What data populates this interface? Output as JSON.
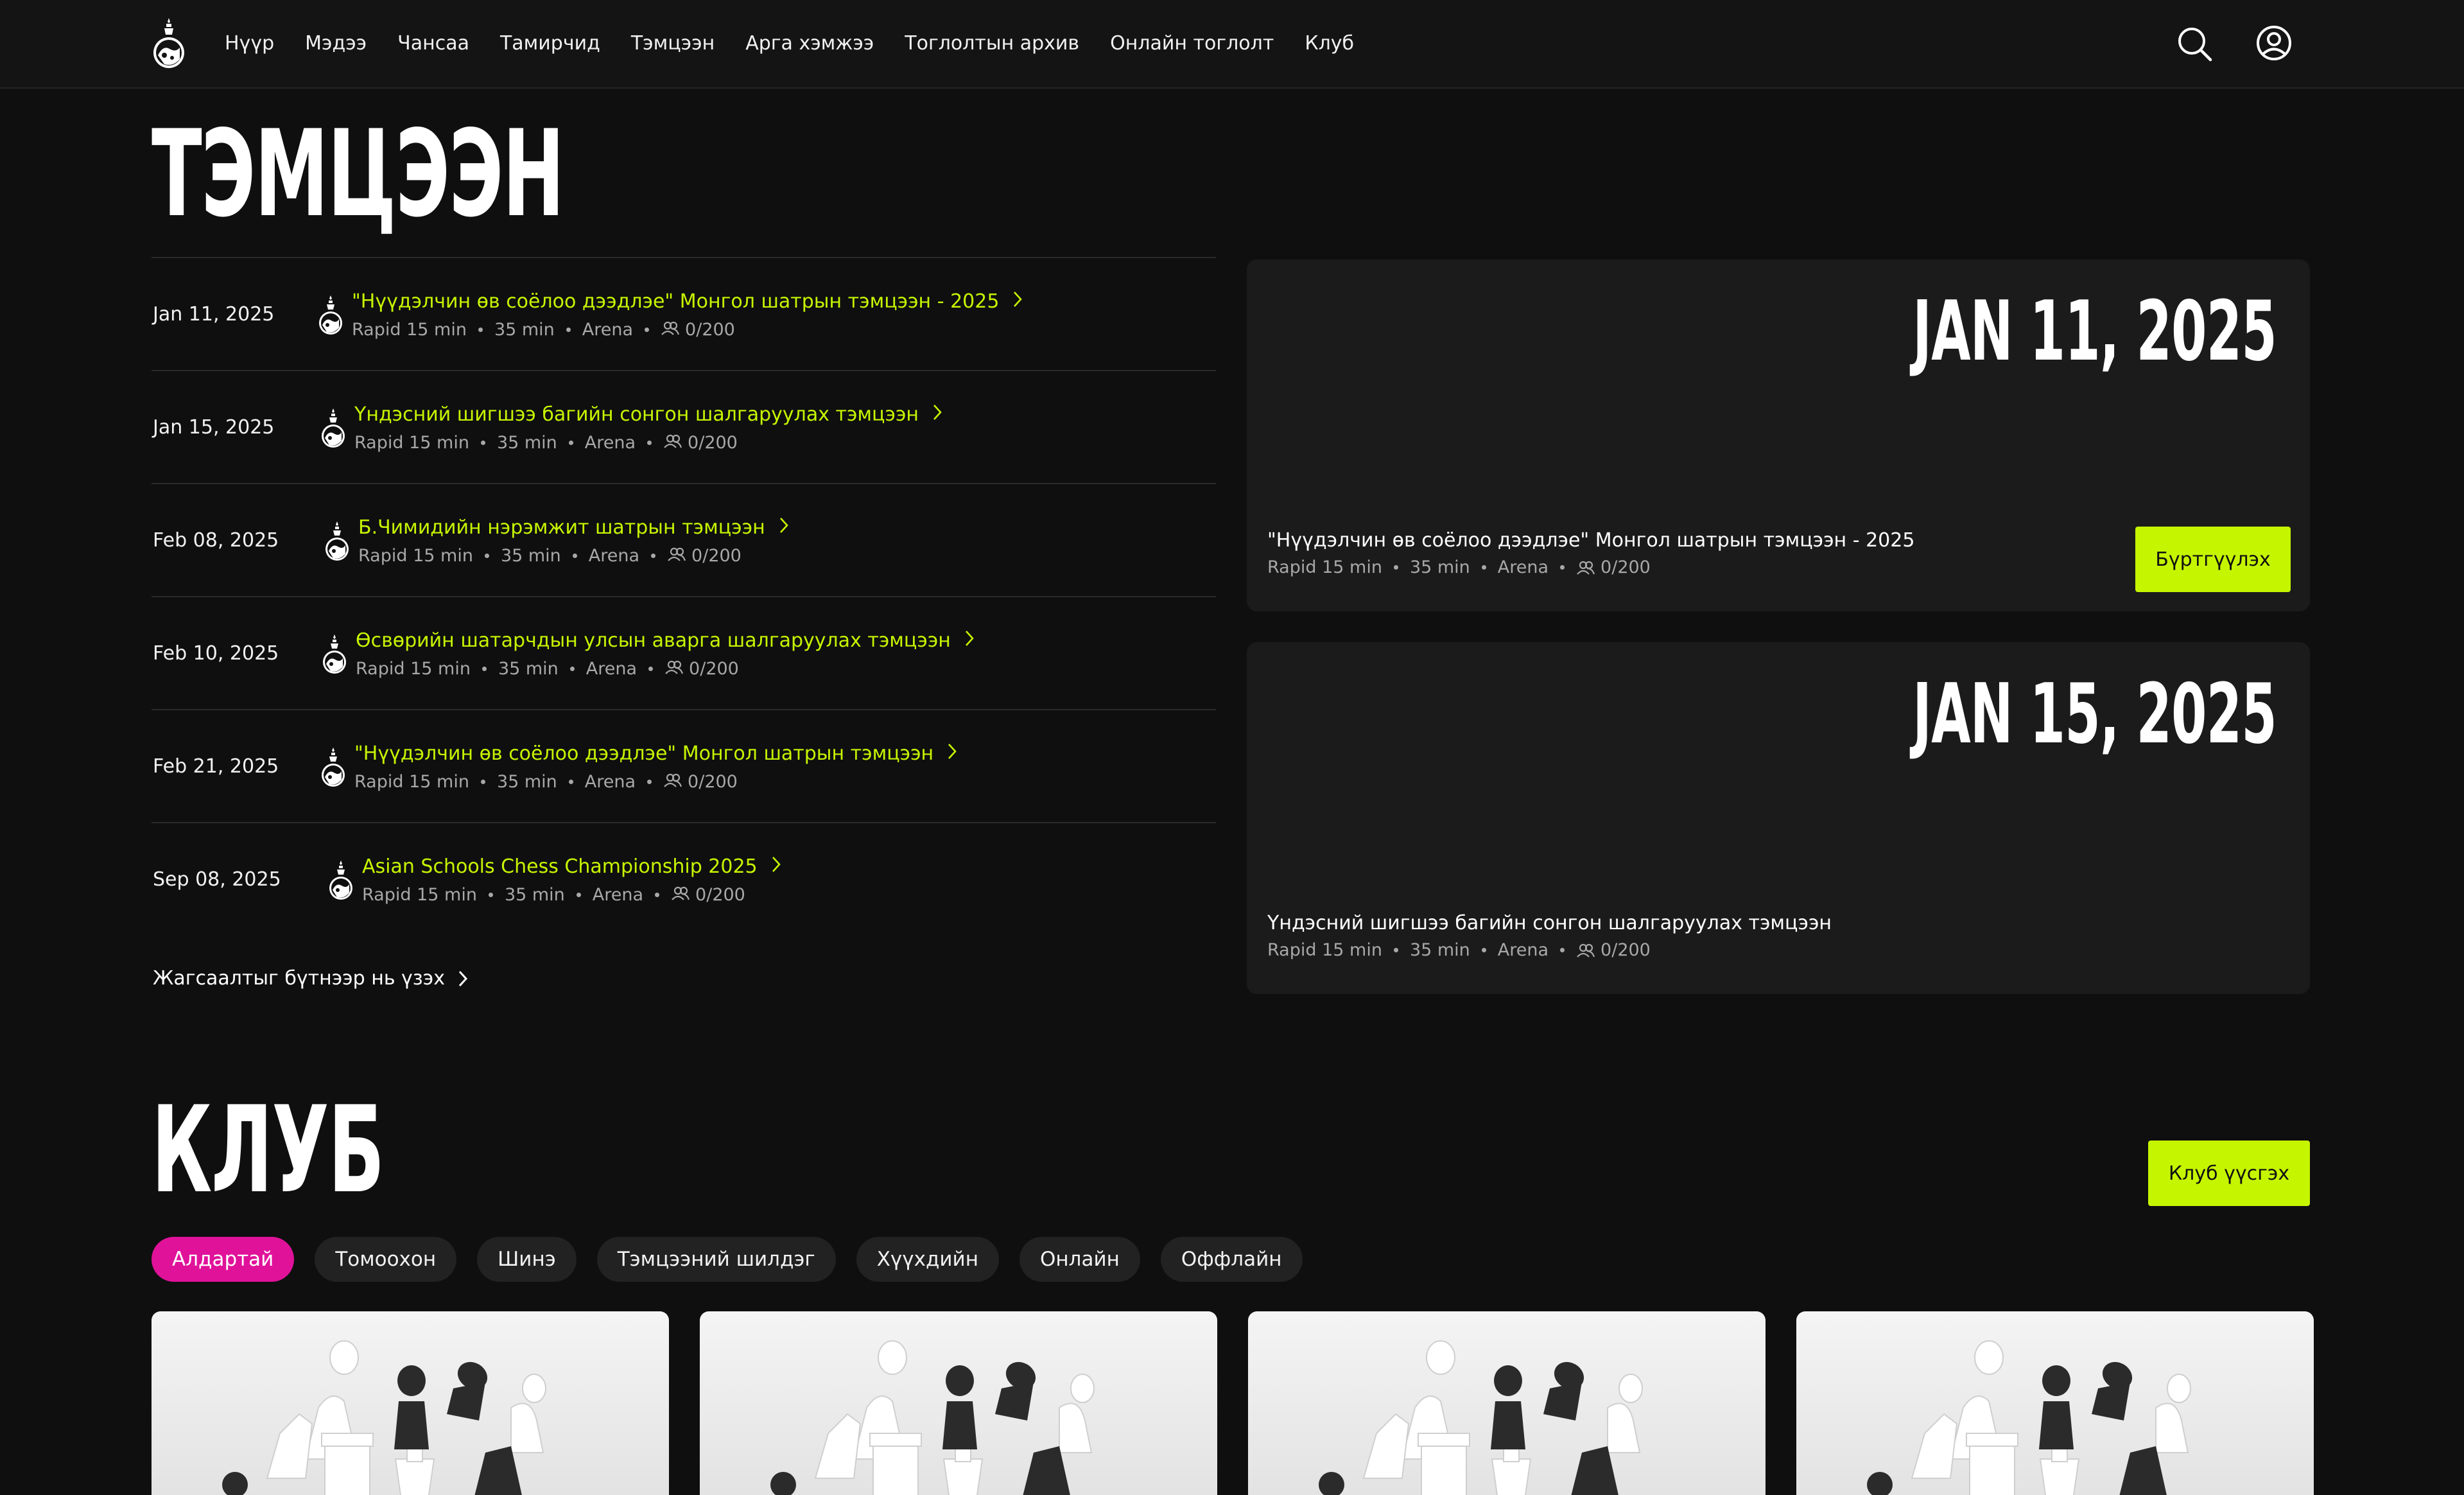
{
  "nav": {
    "items": [
      "Нүүр",
      "Мэдээ",
      "Чансаа",
      "Тамирчид",
      "Тэмцээн",
      "Арга хэмжээ",
      "Тоглолтын архив",
      "Онлайн тоглолт",
      "Клуб"
    ],
    "logo_icon": "chess-king-emblem-icon",
    "search_icon": "search-icon",
    "profile_icon": "user-circle-icon"
  },
  "tournaments": {
    "heading": "ТЭМЦЭЭН",
    "rows": [
      {
        "date": "Jan 11, 2025",
        "title": "\"Нүүдэлчин өв соёлоо дээдлэе\" Монгол шатрын тэмцээн - 2025",
        "format": "Rapid 15 min",
        "duration": "35 min",
        "type": "Arena",
        "participants": "0/200"
      },
      {
        "date": "Jan 15, 2025",
        "title": "Үндэсний шигшээ багийн сонгон шалгаруулах тэмцээн",
        "format": "Rapid 15 min",
        "duration": "35 min",
        "type": "Arena",
        "participants": "0/200"
      },
      {
        "date": "Feb 08, 2025",
        "title": "Б.Чимидийн нэрэмжит шатрын тэмцээн",
        "format": "Rapid 15 min",
        "duration": "35 min",
        "type": "Arena",
        "participants": "0/200"
      },
      {
        "date": "Feb 10, 2025",
        "title": "Өсвөрийн шатарчдын улсын аварга шалгаруулах тэмцээн",
        "format": "Rapid 15 min",
        "duration": "35 min",
        "type": "Arena",
        "participants": "0/200"
      },
      {
        "date": "Feb 21, 2025",
        "title": "\"Нүүдэлчин өв соёлоо дээдлэе\" Монгол шатрын тэмцээн",
        "format": "Rapid 15 min",
        "duration": "35 min",
        "type": "Arena",
        "participants": "0/200"
      },
      {
        "date": "Sep 08, 2025",
        "title": "Asian Schools Chess Championship 2025",
        "format": "Rapid 15 min",
        "duration": "35 min",
        "type": "Arena",
        "participants": "0/200"
      }
    ],
    "see_all": "Жагсаалтыг бүтнээр нь үзэх"
  },
  "featured": [
    {
      "big_date": "JAN 11, 2025",
      "title": "\"Нүүдэлчин өв соёлоо дээдлэе\" Монгол шатрын тэмцээн - 2025",
      "format": "Rapid 15 min",
      "duration": "35 min",
      "type": "Arena",
      "participants": "0/200",
      "button": "Бүртгүүлэх"
    },
    {
      "big_date": "JAN 15, 2025",
      "title": "Үндэсний шигшээ багийн сонгон шалгаруулах тэмцээн",
      "format": "Rapid 15 min",
      "duration": "35 min",
      "type": "Arena",
      "participants": "0/200"
    }
  ],
  "club": {
    "heading": "КЛУБ",
    "create_button": "Клуб үүсгэх",
    "filters": [
      "Алдартай",
      "Томоохон",
      "Шинэ",
      "Тэмцээний шилдэг",
      "Хүүхдийн",
      "Онлайн",
      "Оффлайн"
    ],
    "active_filter": "Алдартай",
    "cards": [
      {
        "image": "chess-pieces-image"
      },
      {
        "image": "chess-pieces-image"
      },
      {
        "image": "chess-pieces-image"
      },
      {
        "image": "chess-pieces-image"
      }
    ]
  },
  "colors": {
    "accent": "#c6f500",
    "active_chip": "#e0129a",
    "background": "#0f0f0f",
    "card": "#1b1b1b"
  }
}
